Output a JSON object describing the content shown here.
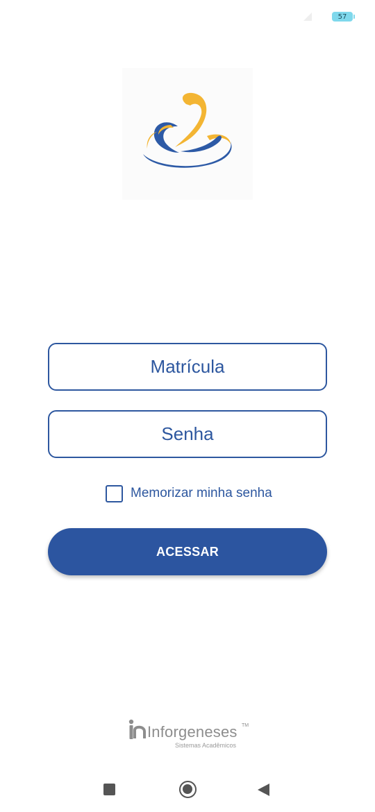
{
  "status_bar": {
    "battery_level": "57",
    "signal_icon": "wifi-signal-icon"
  },
  "logo": {
    "icon": "institution-logo",
    "colors": {
      "yellow": "#f3b533",
      "blue": "#2d5aa6"
    }
  },
  "login_form": {
    "matricula_placeholder": "Matrícula",
    "matricula_value": "",
    "senha_placeholder": "Senha",
    "senha_value": "",
    "remember_label": "Memorizar minha senha",
    "remember_checked": false,
    "submit_label": "ACESSAR"
  },
  "footer": {
    "brand_name": "Inforgeneses",
    "brand_tm": "TM",
    "brand_tagline": "Sistemas Acadêmicos"
  },
  "nav_bar": {
    "recent_icon": "recent-apps-icon",
    "home_icon": "home-icon",
    "back_icon": "back-icon"
  },
  "theme": {
    "primary": "#2c55a0",
    "accent_yellow": "#f3b533",
    "text_gray": "#8d8d8d"
  }
}
